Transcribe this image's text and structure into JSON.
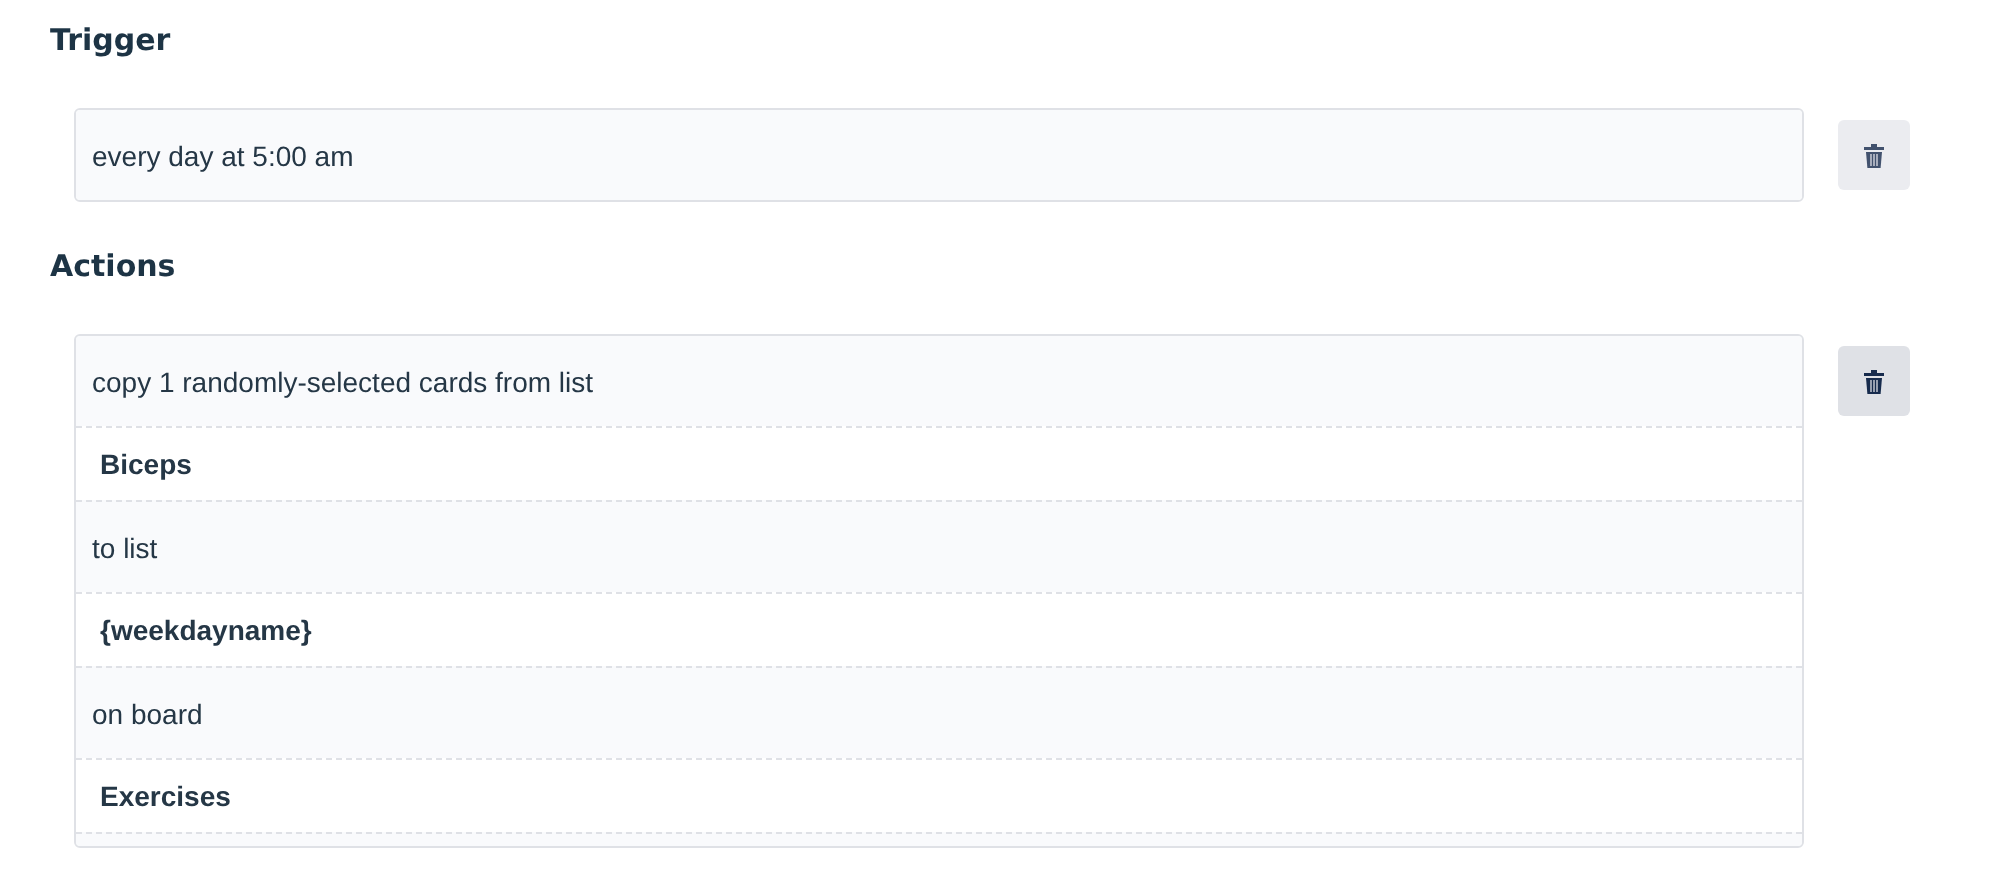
{
  "sections": [
    {
      "heading": "Trigger",
      "delete_button": {
        "highlighted": false
      },
      "rows": [
        {
          "kind": "text",
          "text": "every day at 5:00 am"
        }
      ]
    },
    {
      "heading": "Actions",
      "delete_button": {
        "highlighted": true
      },
      "rows": [
        {
          "kind": "text",
          "text": "copy 1 randomly-selected cards from list"
        },
        {
          "kind": "value",
          "text": "Biceps"
        },
        {
          "kind": "text",
          "text": "to list"
        },
        {
          "kind": "value",
          "text": "{weekdayname}"
        },
        {
          "kind": "text",
          "text": "on board"
        },
        {
          "kind": "value",
          "text": "Exercises"
        }
      ],
      "cut_off_row": true
    }
  ]
}
